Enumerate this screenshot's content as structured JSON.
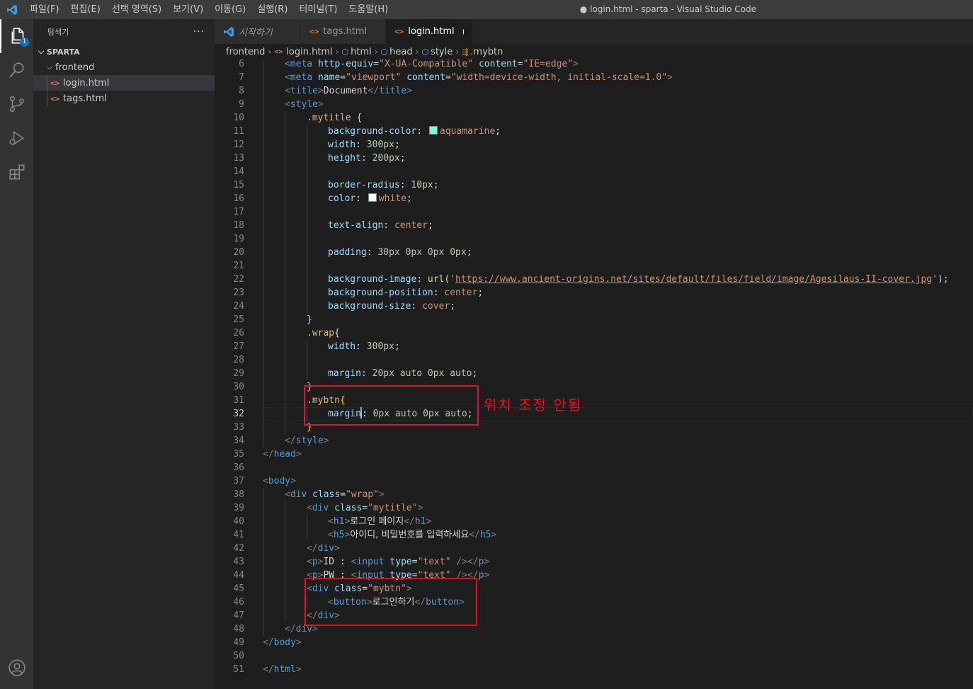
{
  "titlebar": {
    "menus": [
      "파일(F)",
      "편집(E)",
      "선택 영역(S)",
      "보기(V)",
      "이동(G)",
      "실행(R)",
      "터미널(T)",
      "도움말(H)"
    ],
    "window_title": "● login.html - sparta - Visual Studio Code"
  },
  "activity": {
    "explorer_badge": "1"
  },
  "sidebar": {
    "header": "탐색기",
    "more": "···",
    "workspace": "SPARTA",
    "folder": "frontend",
    "files": [
      "login.html",
      "tags.html"
    ]
  },
  "tabs": [
    {
      "label": "시작하기",
      "active": false
    },
    {
      "label": "tags.html",
      "active": false
    },
    {
      "label": "login.html",
      "active": true,
      "dirty": true
    }
  ],
  "breadcrumb": [
    "frontend",
    "login.html",
    "html",
    "head",
    "style",
    ".mybtn"
  ],
  "editor": {
    "current_line": 32,
    "lines": [
      6,
      7,
      8,
      9,
      10,
      11,
      12,
      13,
      14,
      15,
      16,
      17,
      18,
      19,
      20,
      21,
      22,
      23,
      24,
      25,
      26,
      27,
      28,
      29,
      30,
      31,
      32,
      33,
      34,
      35,
      36,
      37,
      38,
      39,
      40,
      41,
      42,
      43,
      44,
      45,
      46,
      47,
      48,
      49,
      50,
      51
    ],
    "code": {
      "l6_tag": "<meta",
      "l6_attr1": "http-equiv",
      "l6_val1": "\"X-UA-Compatible\"",
      "l6_attr2": "content",
      "l6_val2": "\"IE=edge\"",
      "l7_attr1": "name",
      "l7_val1": "\"viewport\"",
      "l7_attr2": "content",
      "l7_val2": "\"width=device-width, initial-scale=1.0\"",
      "l8_text": "Document",
      "l10_sel": ".mytitle",
      "l11_prop": "background-color",
      "l11_val": "aquamarine",
      "l11_color": "#7fffd4",
      "l12_prop": "width",
      "l12_val": "300px",
      "l13_prop": "height",
      "l13_val": "200px",
      "l15_prop": "border-radius",
      "l15_val": "10px",
      "l16_prop": "color",
      "l16_val": "white",
      "l16_color": "#ffffff",
      "l18_prop": "text-align",
      "l18_val": "center",
      "l20_prop": "padding",
      "l20_val": "30px 0px 0px 0px",
      "l22_prop": "background-image",
      "l22_fn": "url",
      "l22_url": "https://www.ancient-origins.net/sites/default/files/field/image/Agesilaus-II-cover.jpg",
      "l23_prop": "background-position",
      "l23_val": "center",
      "l24_prop": "background-size",
      "l24_val": "cover",
      "l26_sel": ".wrap",
      "l27_prop": "width",
      "l27_val": "300px",
      "l29_prop": "margin",
      "l29_val": "20px auto 0px auto",
      "l31_sel": ".mybtn",
      "l32_prop": "margin",
      "l32_val": "0px auto 0px auto",
      "l38_cls": "\"wrap\"",
      "l39_cls": "\"mytitle\"",
      "l40_text": "로그인 페이지",
      "l41_text": "아이디, 비밀번호를 입력하세요",
      "l43_label": "ID : ",
      "l43_type": "\"text\"",
      "l44_label": "PW : ",
      "l44_type": "\"text\"",
      "l45_cls": "\"mybtn\"",
      "l46_text": "로그인하기"
    }
  },
  "annotation": {
    "text": "위치 조정 안됨",
    "color": "#e81123"
  }
}
